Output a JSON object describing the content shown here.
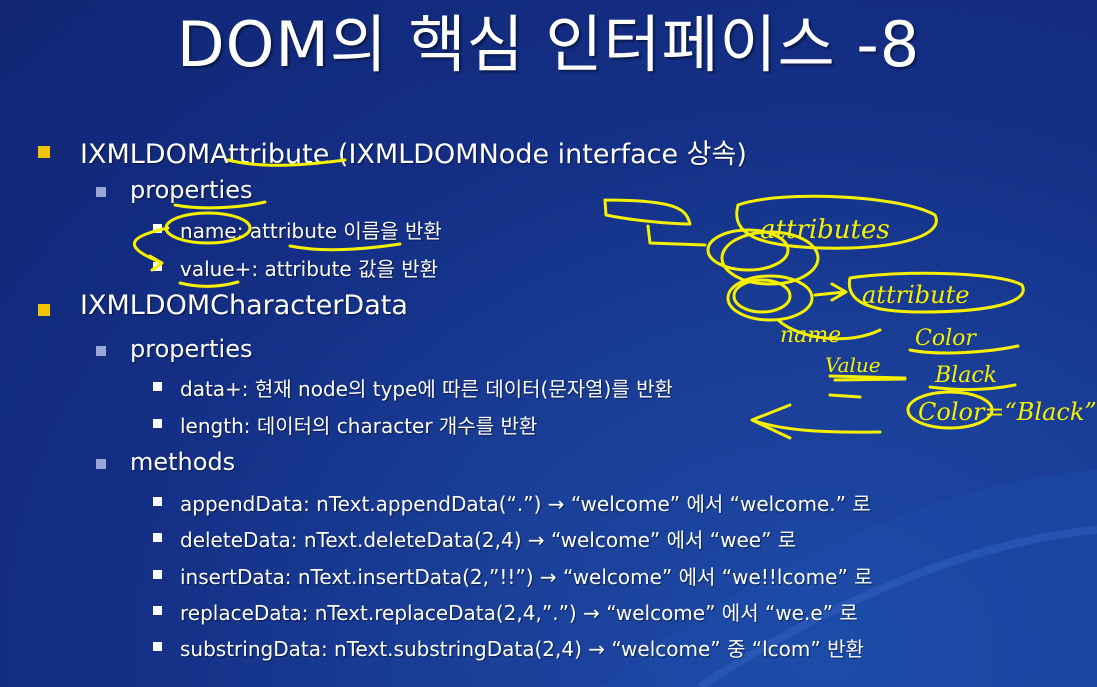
{
  "title": "DOM의 핵심 인터페이스 -8",
  "bullets": [
    {
      "level": 1,
      "text": "IXMLDOMAttribute (IXMLDOMNode interface 상속)"
    },
    {
      "level": 2,
      "text": "properties"
    },
    {
      "level": 3,
      "text": "name: attribute 이름을 반환"
    },
    {
      "level": 3,
      "text": "value+: attribute 값을 반환"
    },
    {
      "level": 1,
      "text": "IXMLDOMCharacterData"
    },
    {
      "level": 2,
      "text": "properties"
    },
    {
      "level": 3,
      "text": "data+: 현재 node의 type에 따른 데이터(문자열)를 반환"
    },
    {
      "level": 3,
      "text": "length: 데이터의 character 개수를 반환"
    },
    {
      "level": 2,
      "text": "methods"
    },
    {
      "level": 3,
      "text": "appendData: nText.appendData(“.”) → “welcome” 에서 “welcome.” 로"
    },
    {
      "level": 3,
      "text": "deleteData: nText.deleteData(2,4) → “welcome” 에서 “wee” 로"
    },
    {
      "level": 3,
      "text": "insertData: nText.insertData(2,”!!”) → “welcome” 에서 “we!!lcome” 로"
    },
    {
      "level": 3,
      "text": "replaceData: nText.replaceData(2,4,”.”) → “welcome” 에서 “we.e” 로"
    },
    {
      "level": 3,
      "text": "substringData: nText.substringData(2,4) →  “welcome” 중 “lcom” 반환"
    }
  ],
  "annotations": {
    "attributes": "attributes",
    "attribute": "attribute",
    "name": "name",
    "value": "Value",
    "color": "Color",
    "black": "Black",
    "color_black": "Color=“Black”"
  },
  "colors": {
    "background": "#142f86",
    "bullet_l1": "#f2c400",
    "ink": "#f5f000"
  }
}
